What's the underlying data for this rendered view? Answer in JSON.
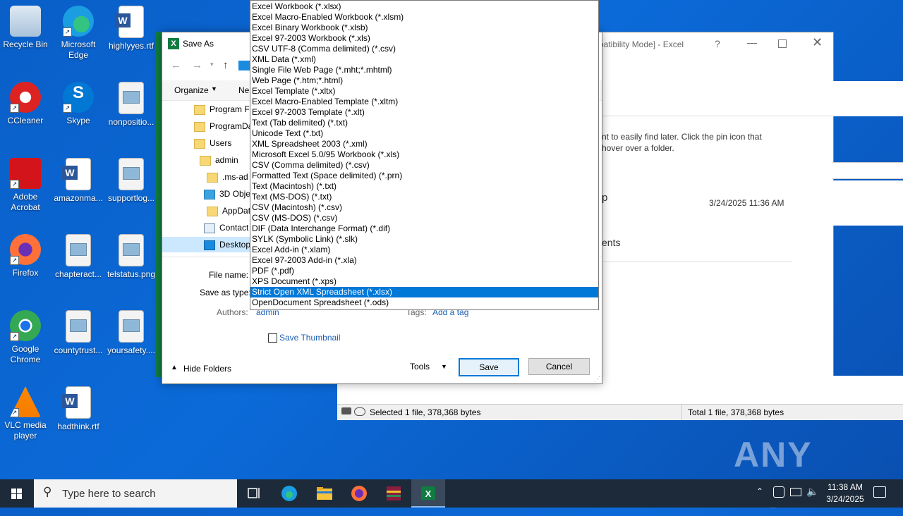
{
  "desktop": {
    "icons": [
      {
        "label": "Recycle Bin",
        "icon": "recycle-bin-icon"
      },
      {
        "label": "Microsoft Edge",
        "icon": "edge-icon"
      },
      {
        "label": "highlyyes.rtf",
        "icon": "word-doc-icon"
      },
      {
        "label": "CCleaner",
        "icon": "ccleaner-icon"
      },
      {
        "label": "Skype",
        "icon": "skype-icon"
      },
      {
        "label": "nonpositio...",
        "icon": "image-file-icon"
      },
      {
        "label": "Adobe Acrobat",
        "icon": "acrobat-icon"
      },
      {
        "label": "amazonma...",
        "icon": "word-doc-icon"
      },
      {
        "label": "supportlog...",
        "icon": "image-file-icon"
      },
      {
        "label": "Firefox",
        "icon": "firefox-icon"
      },
      {
        "label": "chapteract...",
        "icon": "image-file-icon"
      },
      {
        "label": "telstatus.png",
        "icon": "image-file-icon"
      },
      {
        "label": "Google Chrome",
        "icon": "chrome-icon"
      },
      {
        "label": "countytrust...",
        "icon": "image-file-icon"
      },
      {
        "label": "yoursafety....",
        "icon": "image-file-icon"
      },
      {
        "label": "VLC media player",
        "icon": "vlc-icon"
      },
      {
        "label": "hadthink.rtf",
        "icon": "word-doc-icon"
      }
    ]
  },
  "excel_window": {
    "title": "patibility Mode] - Excel",
    "help": "?",
    "pin_hint_1": "nt to easily find later. Click the pin icon that",
    "pin_hint_2": "hover over a folder.",
    "item_name": "p",
    "item_date": "3/24/2025 11:36 AM",
    "section": "ents",
    "status_left": "Selected 1 file, 378,368 bytes",
    "status_right": "Total 1 file, 378,368 bytes"
  },
  "dialog": {
    "title": "Save As",
    "organize": "Organize",
    "new_folder": "Ne",
    "tree": [
      {
        "label": "Program F",
        "icon": "folder-icon"
      },
      {
        "label": "ProgramDa",
        "icon": "folder-icon"
      },
      {
        "label": "Users",
        "icon": "folder-icon"
      },
      {
        "label": "admin",
        "icon": "folder-icon"
      },
      {
        "label": ".ms-ad",
        "icon": "folder-icon"
      },
      {
        "label": "3D Obje",
        "icon": "3d-objects-icon"
      },
      {
        "label": "AppDat",
        "icon": "folder-icon"
      },
      {
        "label": "Contact",
        "icon": "contacts-icon"
      },
      {
        "label": "Desktop",
        "icon": "desktop-icon"
      }
    ],
    "file_name_label": "File name:",
    "save_as_type_label": "Save as type:",
    "authors_label": "Authors:",
    "authors_value": "admin",
    "tags_label": "Tags:",
    "tags_value": "Add a tag",
    "save_thumbnail": "Save Thumbnail",
    "hide_folders": "Hide Folders",
    "tools": "Tools",
    "save": "Save",
    "cancel": "Cancel"
  },
  "type_options": [
    "Excel Workbook (*.xlsx)",
    "Excel Macro-Enabled Workbook (*.xlsm)",
    "Excel Binary Workbook (*.xlsb)",
    "Excel 97-2003 Workbook (*.xls)",
    "CSV UTF-8 (Comma delimited) (*.csv)",
    "XML Data (*.xml)",
    "Single File Web Page (*.mht;*.mhtml)",
    "Web Page (*.htm;*.html)",
    "Excel Template (*.xltx)",
    "Excel Macro-Enabled Template (*.xltm)",
    "Excel 97-2003 Template (*.xlt)",
    "Text (Tab delimited) (*.txt)",
    "Unicode Text (*.txt)",
    "XML Spreadsheet 2003 (*.xml)",
    "Microsoft Excel 5.0/95 Workbook (*.xls)",
    "CSV (Comma delimited) (*.csv)",
    "Formatted Text (Space delimited) (*.prn)",
    "Text (Macintosh) (*.txt)",
    "Text (MS-DOS) (*.txt)",
    "CSV (Macintosh) (*.csv)",
    "CSV (MS-DOS) (*.csv)",
    "DIF (Data Interchange Format) (*.dif)",
    "SYLK (Symbolic Link) (*.slk)",
    "Excel Add-in (*.xlam)",
    "Excel 97-2003 Add-in (*.xla)",
    "PDF (*.pdf)",
    "XPS Document (*.xps)",
    "Strict Open XML Spreadsheet (*.xlsx)",
    "OpenDocument Spreadsheet (*.ods)"
  ],
  "selected_option_index": 27,
  "taskbar": {
    "search_placeholder": "Type here to search",
    "time": "11:38 AM",
    "date": "3/24/2025"
  },
  "watermark": "ANY RUN",
  "colors": {
    "accent": "#0078d7",
    "desktop": "#0b6ad8",
    "excel_green": "#107c41"
  }
}
